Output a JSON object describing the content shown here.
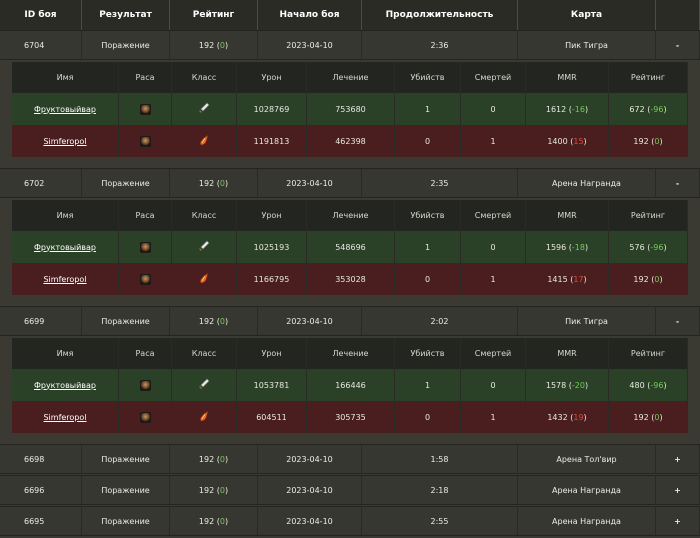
{
  "header": [
    "ID боя",
    "Результат",
    "Рейтинг",
    "Начало боя",
    "Продолжительность",
    "Карта",
    ""
  ],
  "detail_header": [
    "Имя",
    "Раса",
    "Класс",
    "Урон",
    "Лечение",
    "Убийств",
    "Смертей",
    "MMR",
    "Рейтинг"
  ],
  "icons": {
    "race": "troll-portrait-icon",
    "class_win": "white-sword-icon",
    "class_lose": "orange-flame-icon"
  },
  "colors": {
    "win_row": "#2a4127",
    "lose_row": "#4a1e1f",
    "positive": "#6fcf4e",
    "negative": "#e04a3a"
  },
  "matches": [
    {
      "id": "6704",
      "result": "Поражение",
      "rating": "192",
      "rating_delta": "0",
      "start": "2023-04-10",
      "duration": "2:36",
      "map": "Пик Тигра",
      "toggle": "-",
      "players": [
        {
          "name": "Фруктовыйвар",
          "damage": "1028769",
          "healing": "753680",
          "kills": "1",
          "deaths": "0",
          "mmr": "1612",
          "mmr_delta": "-16",
          "rating": "672",
          "rating_delta": "-96",
          "side": "win"
        },
        {
          "name": "Simferopol",
          "damage": "1191813",
          "healing": "462398",
          "kills": "0",
          "deaths": "1",
          "mmr": "1400",
          "mmr_delta": "15",
          "rating": "192",
          "rating_delta": "0",
          "side": "lose"
        }
      ]
    },
    {
      "id": "6702",
      "result": "Поражение",
      "rating": "192",
      "rating_delta": "0",
      "start": "2023-04-10",
      "duration": "2:35",
      "map": "Арена Награнда",
      "toggle": "-",
      "players": [
        {
          "name": "Фруктовыйвар",
          "damage": "1025193",
          "healing": "548696",
          "kills": "1",
          "deaths": "0",
          "mmr": "1596",
          "mmr_delta": "-18",
          "rating": "576",
          "rating_delta": "-96",
          "side": "win"
        },
        {
          "name": "Simferopol",
          "damage": "1166795",
          "healing": "353028",
          "kills": "0",
          "deaths": "1",
          "mmr": "1415",
          "mmr_delta": "17",
          "rating": "192",
          "rating_delta": "0",
          "side": "lose"
        }
      ]
    },
    {
      "id": "6699",
      "result": "Поражение",
      "rating": "192",
      "rating_delta": "0",
      "start": "2023-04-10",
      "duration": "2:02",
      "map": "Пик Тигра",
      "toggle": "-",
      "players": [
        {
          "name": "Фруктовыйвар",
          "damage": "1053781",
          "healing": "166446",
          "kills": "1",
          "deaths": "0",
          "mmr": "1578",
          "mmr_delta": "-20",
          "rating": "480",
          "rating_delta": "-96",
          "side": "win"
        },
        {
          "name": "Simferopol",
          "damage": "604511",
          "healing": "305735",
          "kills": "0",
          "deaths": "1",
          "mmr": "1432",
          "mmr_delta": "19",
          "rating": "192",
          "rating_delta": "0",
          "side": "lose"
        }
      ]
    },
    {
      "id": "6698",
      "result": "Поражение",
      "rating": "192",
      "rating_delta": "0",
      "start": "2023-04-10",
      "duration": "1:58",
      "map": "Арена Тол'вир",
      "toggle": "+",
      "players": []
    },
    {
      "id": "6696",
      "result": "Поражение",
      "rating": "192",
      "rating_delta": "0",
      "start": "2023-04-10",
      "duration": "2:18",
      "map": "Арена Награнда",
      "toggle": "+",
      "players": []
    },
    {
      "id": "6695",
      "result": "Поражение",
      "rating": "192",
      "rating_delta": "0",
      "start": "2023-04-10",
      "duration": "2:55",
      "map": "Арена Награнда",
      "toggle": "+",
      "players": []
    }
  ]
}
